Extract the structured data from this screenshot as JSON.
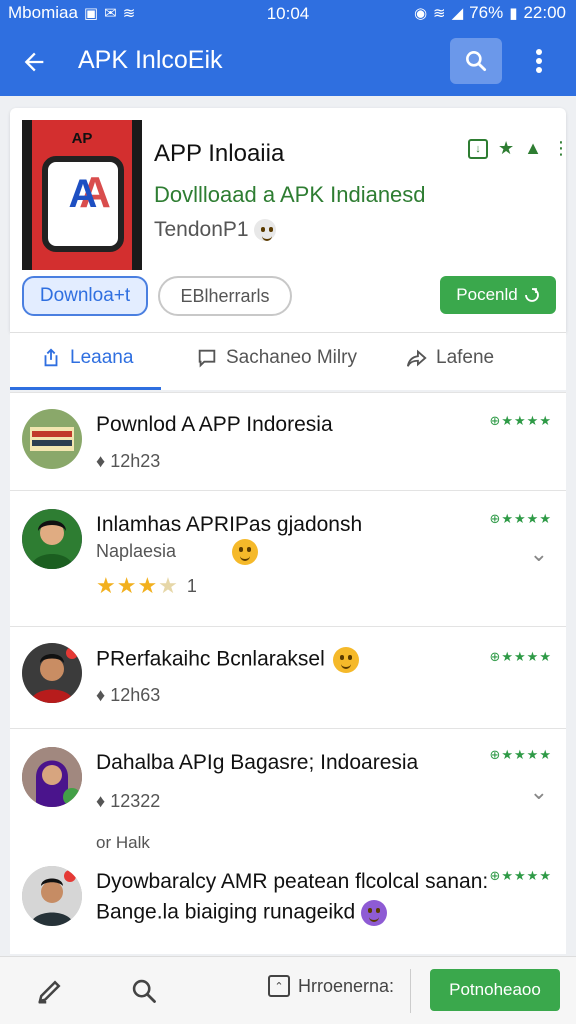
{
  "status_bar": {
    "carrier": "Mbomiaa",
    "time": "10:04",
    "battery": "76%",
    "right_time": "22:00"
  },
  "app_bar": {
    "title": "APK InlcoEik"
  },
  "app": {
    "name": "APP Inloaiia",
    "icon_top_text": "AP",
    "tagline": "Dovllloaad a APK Indianesd",
    "developer": "TendonP1",
    "download_label": "Downloa+t",
    "secondary_label": "EBlherrarls",
    "primary_label": "Pocenld"
  },
  "tabs": [
    {
      "label": "Leaana"
    },
    {
      "label": "Sachaneo Milry"
    },
    {
      "label": "Lafene"
    }
  ],
  "reviews": [
    {
      "title": "Pownlod A  APP Indoresia",
      "meta": "12h23"
    },
    {
      "title": "Inlamhas APRIPas gjadonsh",
      "meta": "Naplaesia",
      "rating_count": "1",
      "rating": 3.5
    },
    {
      "title": "PRerfakaihc Bcnlaraksel",
      "meta": "12h63"
    },
    {
      "title": "Dahalba APIg Bagasre; Indoaresia",
      "meta": "12322",
      "extra": "or Halk"
    },
    {
      "title": "Dyowbaralcy AMR peatean flcolcal sanan:",
      "subtitle": "Bange.la biaiging runageikd"
    }
  ],
  "bottom_bar": {
    "tool_label": "Hrroenerna:",
    "action_label": "Potnoheaoo"
  },
  "colors": {
    "primary": "#2f6fe0",
    "green": "#3aa84c",
    "star": "#f2b01e"
  }
}
